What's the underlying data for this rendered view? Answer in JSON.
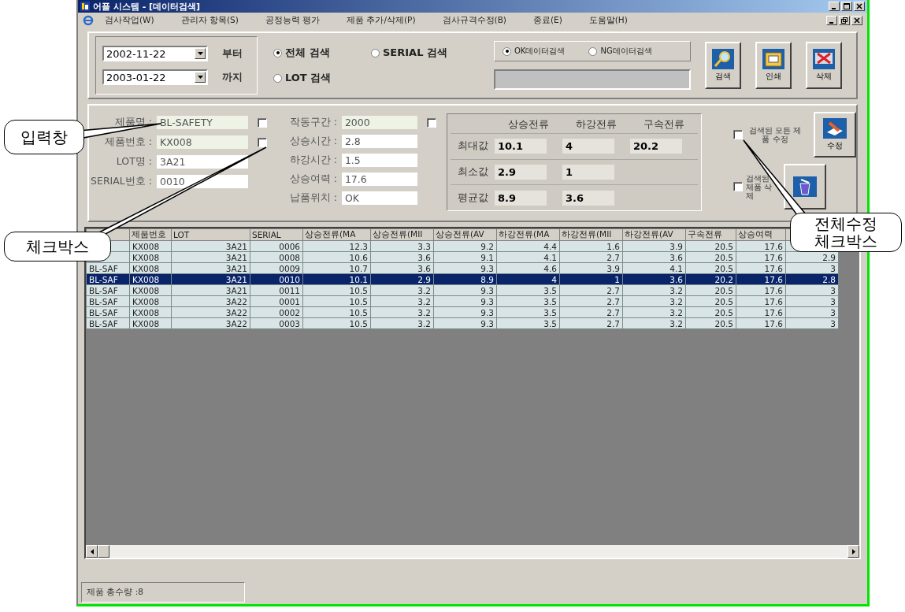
{
  "window": {
    "title": "어플 시스템 - [데이터검색]"
  },
  "menu": [
    "검사작업(W)",
    "관리자 항목(S)",
    "공정능력 평가",
    "제품 추가/삭제(P)",
    "검사규격수정(B)",
    "종료(E)",
    "도움말(H)"
  ],
  "date_range": [
    {
      "value": "2002-11-22",
      "label": "부터"
    },
    {
      "value": "2003-01-22",
      "label": "까지"
    }
  ],
  "search_modes": [
    {
      "label": "전체 검색",
      "selected": true
    },
    {
      "label": "SERIAL 검색",
      "selected": false
    },
    {
      "label": "LOT 검색",
      "selected": false
    }
  ],
  "data_filter": [
    {
      "label": "OK데이터검색",
      "selected": true
    },
    {
      "label": "NG데이터검색",
      "selected": false
    }
  ],
  "toolbar_buttons": [
    {
      "kind": "search",
      "label": "검색"
    },
    {
      "kind": "print",
      "label": "인쇄"
    },
    {
      "kind": "delete",
      "label": "삭제"
    }
  ],
  "product_fields": [
    {
      "label": "제품명 :",
      "value": "BL-SAFETY",
      "highlighted": true,
      "checkbox": {
        "checked": false
      }
    },
    {
      "label": "제품번호 :",
      "value": "KX008",
      "highlighted": true,
      "checkbox": {
        "checked": false
      }
    },
    {
      "label": "LOT명 :",
      "value": "3A21",
      "highlighted": false
    },
    {
      "label": "SERIAL번호 :",
      "value": "0010",
      "highlighted": false
    }
  ],
  "test_fields": [
    {
      "label": "작동구간 :",
      "value": "2000",
      "highlighted": true,
      "checkbox": {
        "checked": false
      }
    },
    {
      "label": "상승시간 :",
      "value": "2.8",
      "highlighted": false
    },
    {
      "label": "하강시간 :",
      "value": "1.5",
      "highlighted": false
    },
    {
      "label": "상승여력 :",
      "value": "17.6",
      "highlighted": false
    },
    {
      "label": "납품위치 :",
      "value": "OK",
      "highlighted": false
    }
  ],
  "stats": {
    "columns": [
      "상승전류",
      "하강전류",
      "구속전류"
    ],
    "rows": [
      {
        "label": "최대값",
        "values": [
          "10.1",
          "4",
          "20.2"
        ]
      },
      {
        "label": "최소값",
        "values": [
          "2.9",
          "1"
        ]
      },
      {
        "label": "평균값",
        "values": [
          "8.9",
          "3.6"
        ]
      }
    ]
  },
  "actions": [
    {
      "kind": "edit",
      "label": "검색된 모든 제품 수정",
      "checked": false,
      "button": "수정"
    },
    {
      "kind": "delete",
      "label": "검색된 제품 삭제",
      "checked": false
    }
  ],
  "table": {
    "columns": [
      {},
      {
        "label": "제품번호"
      },
      {
        "label": "LOT"
      },
      {
        "label": "SERIAL"
      },
      {
        "label": "상승전류(MA"
      },
      {
        "label": "상승전류(MII"
      },
      {
        "label": "상승전류(AV"
      },
      {
        "label": "하강전류(MA"
      },
      {
        "label": "하강전류(MII"
      },
      {
        "label": "하강전류(AV"
      },
      {
        "label": "구속전류"
      },
      {
        "label": "상승여력"
      },
      {}
    ],
    "rows": [
      {
        "selected": false,
        "cells": [
          null,
          "KX008",
          "3A21",
          "0006",
          "12.3",
          "3.3",
          "9.2",
          "4.4",
          "1.6",
          "3.9",
          "20.5",
          "17.6",
          null
        ]
      },
      {
        "selected": false,
        "cells": [
          null,
          "KX008",
          "3A21",
          "0008",
          "10.6",
          "3.6",
          "9.1",
          "4.1",
          "2.7",
          "3.6",
          "20.5",
          "17.6",
          "2.9"
        ]
      },
      {
        "selected": false,
        "cells": [
          "BL-SAF",
          "KX008",
          "3A21",
          "0009",
          "10.7",
          "3.6",
          "9.3",
          "4.6",
          "3.9",
          "4.1",
          "20.5",
          "17.6",
          "3"
        ]
      },
      {
        "selected": true,
        "cells": [
          "BL-SAF",
          "KX008",
          "3A21",
          "0010",
          "10.1",
          "2.9",
          "8.9",
          "4",
          "1",
          "3.6",
          "20.2",
          "17.6",
          "2.8"
        ]
      },
      {
        "selected": false,
        "cells": [
          "BL-SAF",
          "KX008",
          "3A21",
          "0011",
          "10.5",
          "3.2",
          "9.3",
          "3.5",
          "2.7",
          "3.2",
          "20.5",
          "17.6",
          "3"
        ]
      },
      {
        "selected": false,
        "cells": [
          "BL-SAF",
          "KX008",
          "3A22",
          "0001",
          "10.5",
          "3.2",
          "9.3",
          "3.5",
          "2.7",
          "3.2",
          "20.5",
          "17.6",
          "3"
        ]
      },
      {
        "selected": false,
        "cells": [
          "BL-SAF",
          "KX008",
          "3A22",
          "0002",
          "10.5",
          "3.2",
          "9.3",
          "3.5",
          "2.7",
          "3.2",
          "20.5",
          "17.6",
          "3"
        ]
      },
      {
        "selected": false,
        "cells": [
          "BL-SAF",
          "KX008",
          "3A22",
          "0003",
          "10.5",
          "3.2",
          "9.3",
          "3.5",
          "2.7",
          "3.2",
          "20.5",
          "17.6",
          "3"
        ]
      }
    ]
  },
  "status_bar": "제품 총수량 :8",
  "callouts": [
    "입력창",
    "체크박스",
    "전체수정 체크박스"
  ]
}
